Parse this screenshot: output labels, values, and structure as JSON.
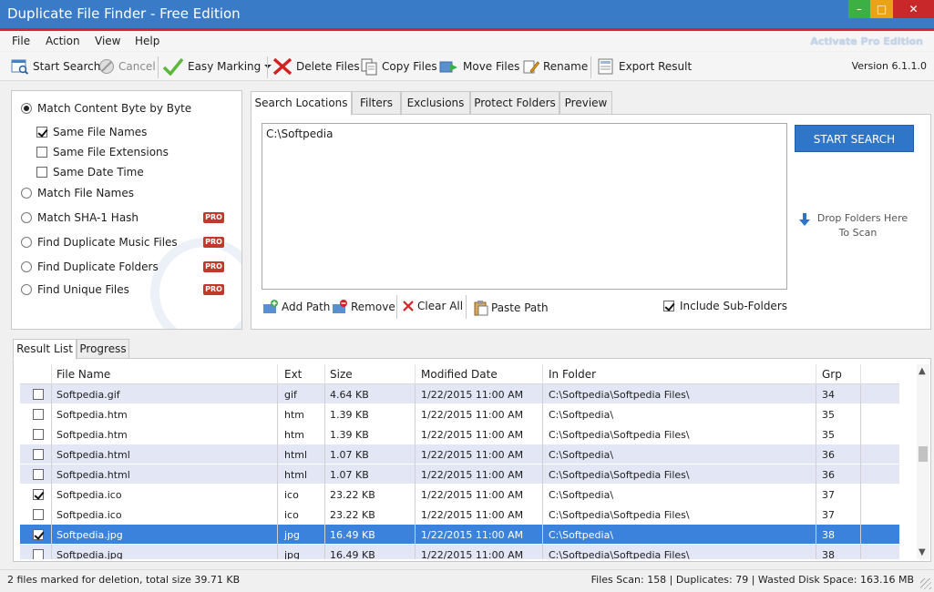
{
  "window": {
    "title": "Duplicate File Finder - Free Edition",
    "minimize": "–",
    "maximize": "□",
    "close": "✕"
  },
  "menu": {
    "items": [
      "File",
      "Action",
      "View",
      "Help"
    ],
    "activate": "Activate Pro Edition"
  },
  "toolbar": {
    "start_search": "Start Search",
    "cancel": "Cancel",
    "easy_marking": "Easy Marking",
    "delete_files": "Delete Files",
    "copy_files": "Copy Files",
    "move_files": "Move Files",
    "rename": "Rename",
    "export_result": "Export Result",
    "version": "Version 6.1.1.0"
  },
  "options": {
    "match_content": "Match Content Byte by Byte",
    "same_file_names": "Same File Names",
    "same_file_extensions": "Same File Extensions",
    "same_date_time": "Same Date Time",
    "match_file_names": "Match File Names",
    "match_sha1": "Match SHA-1 Hash",
    "find_music": "Find Duplicate Music Files",
    "find_folders": "Find Duplicate Folders",
    "find_unique": "Find Unique Files",
    "pro_badge": "PRO"
  },
  "search_tabs": [
    "Search Locations",
    "Filters",
    "Exclusions",
    "Protect Folders",
    "Preview"
  ],
  "search": {
    "path": "C:\\Softpedia",
    "start_button": "START SEARCH",
    "drop_hint_1": "Drop Folders Here",
    "drop_hint_2": "To Scan",
    "add_path": "Add Path",
    "remove": "Remove",
    "clear_all": "Clear All",
    "paste_path": "Paste Path",
    "include_sub": "Include Sub-Folders"
  },
  "result_tabs": [
    "Result List",
    "Progress"
  ],
  "table": {
    "columns": [
      "File Name",
      "Ext",
      "Size",
      "Modified Date",
      "In Folder",
      "Grp"
    ],
    "rows": [
      {
        "checked": false,
        "name": "Softpedia.gif",
        "ext": "gif",
        "size": "4.64 KB",
        "date": "1/22/2015 11:00 AM",
        "folder": "C:\\Softpedia\\Softpedia Files\\",
        "grp": "34"
      },
      {
        "checked": false,
        "name": "Softpedia.htm",
        "ext": "htm",
        "size": "1.39 KB",
        "date": "1/22/2015 11:00 AM",
        "folder": "C:\\Softpedia\\",
        "grp": "35"
      },
      {
        "checked": false,
        "name": "Softpedia.htm",
        "ext": "htm",
        "size": "1.39 KB",
        "date": "1/22/2015 11:00 AM",
        "folder": "C:\\Softpedia\\Softpedia Files\\",
        "grp": "35"
      },
      {
        "checked": false,
        "name": "Softpedia.html",
        "ext": "html",
        "size": "1.07 KB",
        "date": "1/22/2015 11:00 AM",
        "folder": "C:\\Softpedia\\",
        "grp": "36"
      },
      {
        "checked": false,
        "name": "Softpedia.html",
        "ext": "html",
        "size": "1.07 KB",
        "date": "1/22/2015 11:00 AM",
        "folder": "C:\\Softpedia\\Softpedia Files\\",
        "grp": "36"
      },
      {
        "checked": true,
        "name": "Softpedia.ico",
        "ext": "ico",
        "size": "23.22 KB",
        "date": "1/22/2015 11:00 AM",
        "folder": "C:\\Softpedia\\",
        "grp": "37"
      },
      {
        "checked": false,
        "name": "Softpedia.ico",
        "ext": "ico",
        "size": "23.22 KB",
        "date": "1/22/2015 11:00 AM",
        "folder": "C:\\Softpedia\\Softpedia Files\\",
        "grp": "37"
      },
      {
        "checked": true,
        "name": "Softpedia.jpg",
        "ext": "jpg",
        "size": "16.49 KB",
        "date": "1/22/2015 11:00 AM",
        "folder": "C:\\Softpedia\\",
        "grp": "38"
      },
      {
        "checked": false,
        "name": "Softpedia.jpg",
        "ext": "jpg",
        "size": "16.49 KB",
        "date": "1/22/2015 11:00 AM",
        "folder": "C:\\Softpedia\\Softpedia Files\\",
        "grp": "38"
      }
    ]
  },
  "status": {
    "left": "2 files marked for deletion, total size 39.71 KB",
    "right": "Files Scan: 158 | Duplicates: 79 | Wasted Disk Space: 163.16 MB"
  }
}
